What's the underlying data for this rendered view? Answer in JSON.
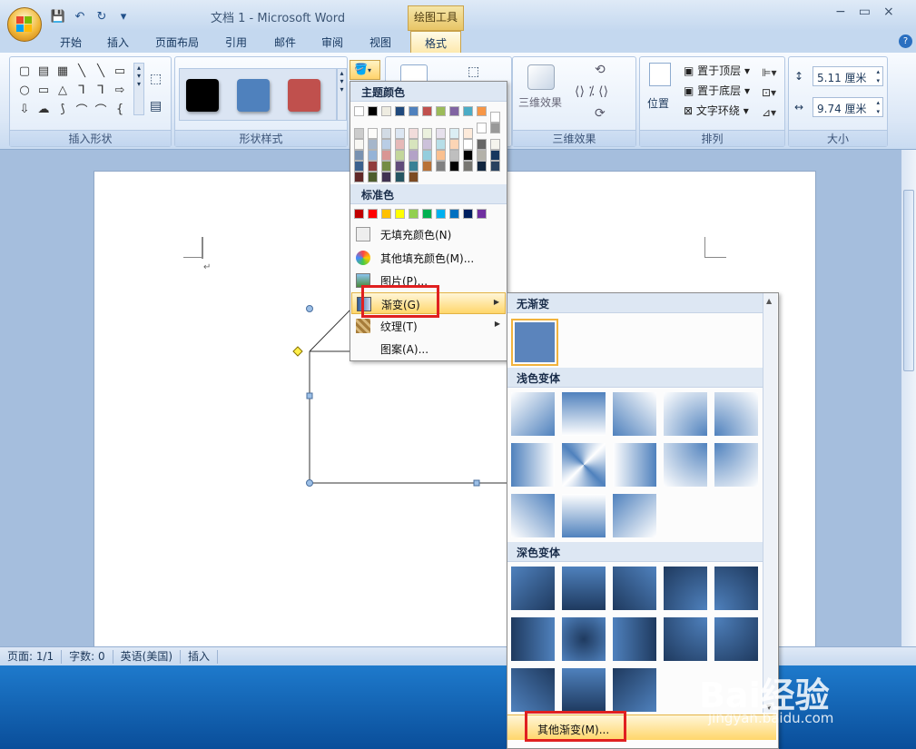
{
  "window": {
    "title": "文档 1 - Microsoft Word",
    "context_tool": "绘图工具",
    "min": "−",
    "max": "▭",
    "close": "×"
  },
  "qat": {
    "save": "💾",
    "undo": "↶",
    "redo": "↻",
    "more": "▾"
  },
  "tabs": [
    "开始",
    "插入",
    "页面布局",
    "引用",
    "邮件",
    "审阅",
    "视图",
    "格式"
  ],
  "help": "?",
  "ribbon": {
    "groups": {
      "insert_shapes": "插入形状",
      "shape_styles": "形状样式",
      "effects_3d": "三维效果",
      "arrange": "排列",
      "size": "大小"
    },
    "shape_glyphs": [
      "▢",
      "▤",
      "▦",
      "╲",
      "╲",
      "▭",
      "○",
      "▭",
      "△",
      "⅂",
      "⅂",
      "⇨",
      "⇩",
      "☁",
      "⟆",
      "⌒",
      "⌒",
      "{"
    ],
    "style_colors": [
      "#000000",
      "#4f81bd",
      "#c0504d"
    ],
    "effects_3d_label": "三维效果",
    "position_label": "位置",
    "bring_front": "置于顶层",
    "send_back": "置于底层",
    "text_wrap": "文字环绕",
    "height_value": "5.11 厘米",
    "width_value": "9.74 厘米"
  },
  "statusbar": {
    "page": "页面: 1/1",
    "words": "字数: 0",
    "language": "英语(美国)",
    "mode": "插入"
  },
  "color_menu": {
    "theme_header": "主题颜色",
    "standard_header": "标准色",
    "theme_row": [
      "#ffffff",
      "#000000",
      "#eeece1",
      "#1f497d",
      "#4f81bd",
      "#c0504d",
      "#9bbb59",
      "#8064a2",
      "#4bacc6",
      "#f79646"
    ],
    "standard_row": [
      "#c00000",
      "#ff0000",
      "#ffc000",
      "#ffff00",
      "#92d050",
      "#00b050",
      "#00b0f0",
      "#0070c0",
      "#002060",
      "#7030a0"
    ],
    "items": [
      "无填充颜色(N)",
      "其他填充颜色(M)...",
      "图片(P)...",
      "渐变(G)",
      "纹理(T)",
      "图案(A)..."
    ]
  },
  "gradient_menu": {
    "none_header": "无渐变",
    "light_header": "浅色变体",
    "dark_header": "深色变体",
    "more": "其他渐变(M)...",
    "base_color": "#4f81bd"
  },
  "watermark": {
    "brand": "Bai经验",
    "url": "jingyan.baidu.com"
  }
}
